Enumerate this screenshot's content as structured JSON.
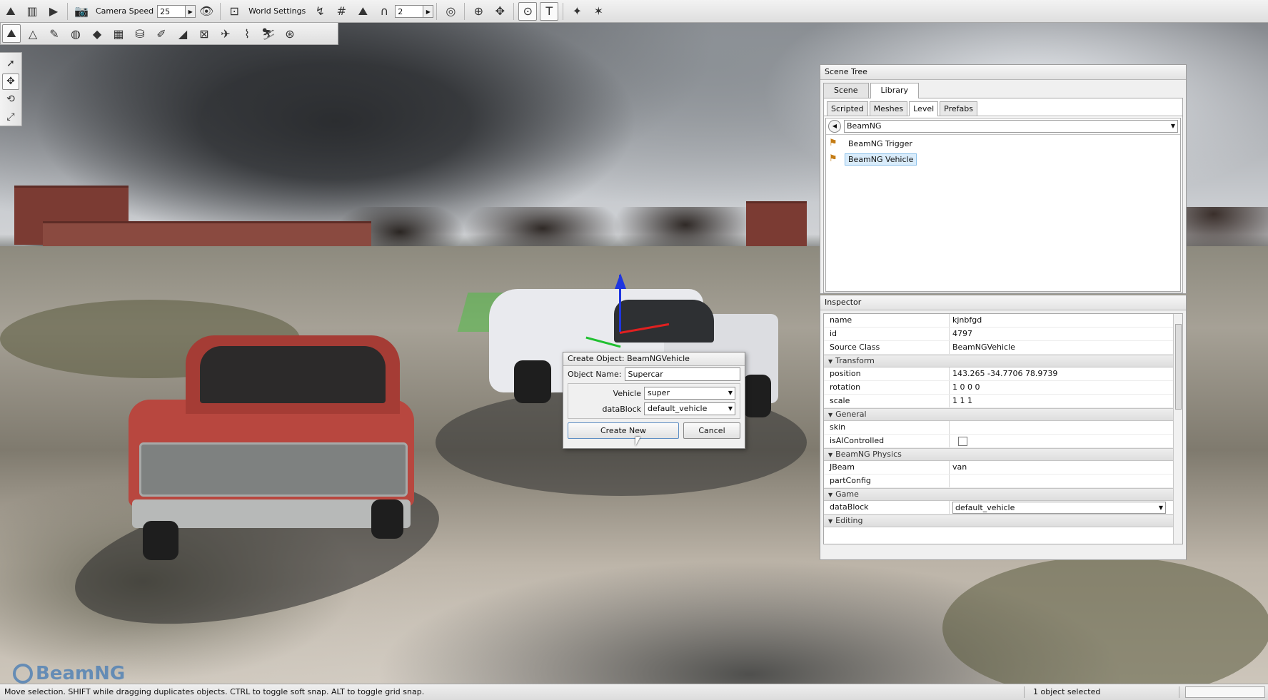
{
  "toolbar": {
    "camera_speed_label": "Camera Speed",
    "camera_speed_value": "25",
    "world_settings_label": "World Settings",
    "snap_value": "2"
  },
  "scene_tree": {
    "title": "Scene Tree",
    "tabs": [
      {
        "label": "Scene"
      },
      {
        "label": "Library"
      }
    ],
    "subtabs": [
      {
        "label": "Scripted"
      },
      {
        "label": "Meshes"
      },
      {
        "label": "Level"
      },
      {
        "label": "Prefabs"
      }
    ],
    "path": "BeamNG",
    "items": [
      {
        "label": "BeamNG Trigger",
        "icon": "trigger-icon"
      },
      {
        "label": "BeamNG Vehicle",
        "icon": "vehicle-icon"
      }
    ]
  },
  "inspector": {
    "title": "Inspector",
    "rows_top": [
      {
        "key": "name",
        "value": "kjnbfgd"
      },
      {
        "key": "id",
        "value": "4797"
      },
      {
        "key": "Source Class",
        "value": "BeamNGVehicle"
      }
    ],
    "groups": {
      "transform": {
        "label": "Transform",
        "rows": [
          {
            "key": "position",
            "value": "143.265 -34.7706 78.9739"
          },
          {
            "key": "rotation",
            "value": "1 0 0 0"
          },
          {
            "key": "scale",
            "value": "1 1 1"
          }
        ]
      },
      "general": {
        "label": "General",
        "rows": [
          {
            "key": "skin",
            "value": ""
          },
          {
            "key": "isAIControlled",
            "value": ""
          }
        ]
      },
      "physics": {
        "label": "BeamNG Physics",
        "rows": [
          {
            "key": "JBeam",
            "value": "van"
          },
          {
            "key": "partConfig",
            "value": ""
          }
        ]
      },
      "game": {
        "label": "Game",
        "rows": [
          {
            "key": "dataBlock",
            "value": "default_vehicle"
          }
        ]
      },
      "editing": {
        "label": "Editing"
      }
    }
  },
  "dialog": {
    "title": "Create Object: BeamNGVehicle",
    "object_name_label": "Object Name:",
    "object_name_value": "Supercar",
    "vehicle_label": "Vehicle",
    "vehicle_value": "super",
    "datablock_label": "dataBlock",
    "datablock_value": "default_vehicle",
    "create_label": "Create New",
    "cancel_label": "Cancel"
  },
  "viewport": {
    "logo_text": "BeamNG"
  },
  "statusbar": {
    "message": "Move selection.  SHIFT while dragging duplicates objects.  CTRL to toggle soft snap.  ALT to toggle grid snap.",
    "selection": "1 object selected"
  }
}
